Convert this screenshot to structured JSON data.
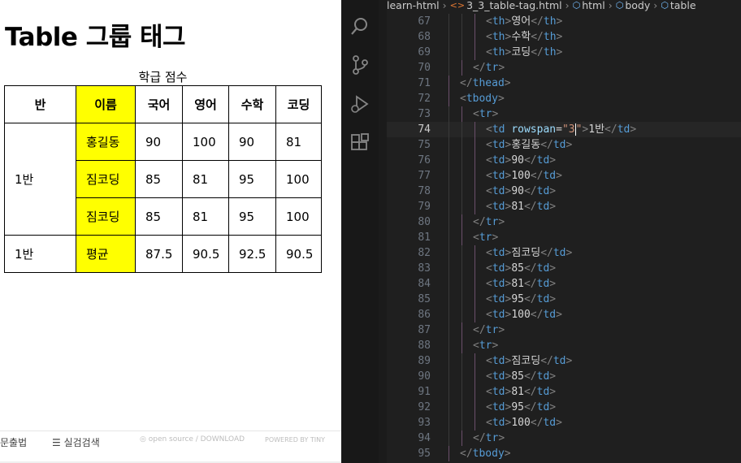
{
  "preview": {
    "title": "Table 그룹 태그",
    "caption": "학급 점수",
    "headers": [
      "반",
      "이름",
      "국어",
      "영어",
      "수학",
      "코딩"
    ],
    "group1": {
      "class": "1반",
      "rows": [
        {
          "name": "홍길동",
          "scores": [
            "90",
            "100",
            "90",
            "81"
          ]
        },
        {
          "name": "짐코딩",
          "scores": [
            "85",
            "81",
            "95",
            "100"
          ]
        },
        {
          "name": "짐코딩",
          "scores": [
            "85",
            "81",
            "95",
            "100"
          ]
        }
      ]
    },
    "avg_row": {
      "class": "1반",
      "name": "평균",
      "scores": [
        "87.5",
        "90.5",
        "92.5",
        "90.5"
      ]
    },
    "highlight_color": "#ffff00"
  },
  "bottom_strip": {
    "left_text": "문출법",
    "search_text": "실검검색",
    "open_source": "open source / DOWNLOAD",
    "powered": "POWERED BY TINY"
  },
  "editor": {
    "breadcrumb": [
      "learn-html",
      "3_3_table-tag.html",
      "html",
      "body",
      "table"
    ],
    "cursor_line": 74,
    "activity_icons": [
      "explorer-icon",
      "search-icon",
      "source-control-icon",
      "run-debug-icon",
      "extensions-icon"
    ],
    "lines": [
      {
        "n": "67",
        "indent": 3,
        "parts": [
          [
            "br",
            "<"
          ],
          [
            "tag",
            "th"
          ],
          [
            "br",
            ">"
          ],
          [
            "tx",
            "영어"
          ],
          [
            "br",
            "</"
          ],
          [
            "tag",
            "th"
          ],
          [
            "br",
            ">"
          ]
        ]
      },
      {
        "n": "68",
        "indent": 3,
        "parts": [
          [
            "br",
            "<"
          ],
          [
            "tag",
            "th"
          ],
          [
            "br",
            ">"
          ],
          [
            "tx",
            "수학"
          ],
          [
            "br",
            "</"
          ],
          [
            "tag",
            "th"
          ],
          [
            "br",
            ">"
          ]
        ]
      },
      {
        "n": "69",
        "indent": 3,
        "parts": [
          [
            "br",
            "<"
          ],
          [
            "tag",
            "th"
          ],
          [
            "br",
            ">"
          ],
          [
            "tx",
            "코딩"
          ],
          [
            "br",
            "</"
          ],
          [
            "tag",
            "th"
          ],
          [
            "br",
            ">"
          ]
        ]
      },
      {
        "n": "70",
        "indent": 2,
        "parts": [
          [
            "br",
            "</"
          ],
          [
            "tag",
            "tr"
          ],
          [
            "br",
            ">"
          ]
        ]
      },
      {
        "n": "71",
        "indent": 1,
        "parts": [
          [
            "br",
            "</"
          ],
          [
            "tag",
            "thead"
          ],
          [
            "br",
            ">"
          ]
        ]
      },
      {
        "n": "72",
        "indent": 1,
        "parts": [
          [
            "br",
            "<"
          ],
          [
            "tag",
            "tbody"
          ],
          [
            "br",
            ">"
          ]
        ]
      },
      {
        "n": "73",
        "indent": 2,
        "parts": [
          [
            "br",
            "<"
          ],
          [
            "tag",
            "tr"
          ],
          [
            "br",
            ">"
          ]
        ]
      },
      {
        "n": "74",
        "indent": 3,
        "parts": [
          [
            "br",
            "<"
          ],
          [
            "tag",
            "td"
          ],
          [
            "tx",
            " "
          ],
          [
            "attr",
            "rowspan"
          ],
          [
            "tx",
            "="
          ],
          [
            "str",
            "\"3"
          ],
          [
            "cursor",
            ""
          ],
          [
            "str",
            "\""
          ],
          [
            "br",
            ">"
          ],
          [
            "tx",
            "1반"
          ],
          [
            "br",
            "</"
          ],
          [
            "tag",
            "td"
          ],
          [
            "br",
            ">"
          ]
        ]
      },
      {
        "n": "75",
        "indent": 3,
        "parts": [
          [
            "br",
            "<"
          ],
          [
            "tag",
            "td"
          ],
          [
            "br",
            ">"
          ],
          [
            "tx",
            "홍길동"
          ],
          [
            "br",
            "</"
          ],
          [
            "tag",
            "td"
          ],
          [
            "br",
            ">"
          ]
        ]
      },
      {
        "n": "76",
        "indent": 3,
        "parts": [
          [
            "br",
            "<"
          ],
          [
            "tag",
            "td"
          ],
          [
            "br",
            ">"
          ],
          [
            "tx",
            "90"
          ],
          [
            "br",
            "</"
          ],
          [
            "tag",
            "td"
          ],
          [
            "br",
            ">"
          ]
        ]
      },
      {
        "n": "77",
        "indent": 3,
        "parts": [
          [
            "br",
            "<"
          ],
          [
            "tag",
            "td"
          ],
          [
            "br",
            ">"
          ],
          [
            "tx",
            "100"
          ],
          [
            "br",
            "</"
          ],
          [
            "tag",
            "td"
          ],
          [
            "br",
            ">"
          ]
        ]
      },
      {
        "n": "78",
        "indent": 3,
        "parts": [
          [
            "br",
            "<"
          ],
          [
            "tag",
            "td"
          ],
          [
            "br",
            ">"
          ],
          [
            "tx",
            "90"
          ],
          [
            "br",
            "</"
          ],
          [
            "tag",
            "td"
          ],
          [
            "br",
            ">"
          ]
        ]
      },
      {
        "n": "79",
        "indent": 3,
        "parts": [
          [
            "br",
            "<"
          ],
          [
            "tag",
            "td"
          ],
          [
            "br",
            ">"
          ],
          [
            "tx",
            "81"
          ],
          [
            "br",
            "</"
          ],
          [
            "tag",
            "td"
          ],
          [
            "br",
            ">"
          ]
        ]
      },
      {
        "n": "80",
        "indent": 2,
        "parts": [
          [
            "br",
            "</"
          ],
          [
            "tag",
            "tr"
          ],
          [
            "br",
            ">"
          ]
        ]
      },
      {
        "n": "81",
        "indent": 2,
        "parts": [
          [
            "br",
            "<"
          ],
          [
            "tag",
            "tr"
          ],
          [
            "br",
            ">"
          ]
        ]
      },
      {
        "n": "82",
        "indent": 3,
        "parts": [
          [
            "br",
            "<"
          ],
          [
            "tag",
            "td"
          ],
          [
            "br",
            ">"
          ],
          [
            "tx",
            "짐코딩"
          ],
          [
            "br",
            "</"
          ],
          [
            "tag",
            "td"
          ],
          [
            "br",
            ">"
          ]
        ]
      },
      {
        "n": "83",
        "indent": 3,
        "parts": [
          [
            "br",
            "<"
          ],
          [
            "tag",
            "td"
          ],
          [
            "br",
            ">"
          ],
          [
            "tx",
            "85"
          ],
          [
            "br",
            "</"
          ],
          [
            "tag",
            "td"
          ],
          [
            "br",
            ">"
          ]
        ]
      },
      {
        "n": "84",
        "indent": 3,
        "parts": [
          [
            "br",
            "<"
          ],
          [
            "tag",
            "td"
          ],
          [
            "br",
            ">"
          ],
          [
            "tx",
            "81"
          ],
          [
            "br",
            "</"
          ],
          [
            "tag",
            "td"
          ],
          [
            "br",
            ">"
          ]
        ]
      },
      {
        "n": "85",
        "indent": 3,
        "parts": [
          [
            "br",
            "<"
          ],
          [
            "tag",
            "td"
          ],
          [
            "br",
            ">"
          ],
          [
            "tx",
            "95"
          ],
          [
            "br",
            "</"
          ],
          [
            "tag",
            "td"
          ],
          [
            "br",
            ">"
          ]
        ]
      },
      {
        "n": "86",
        "indent": 3,
        "parts": [
          [
            "br",
            "<"
          ],
          [
            "tag",
            "td"
          ],
          [
            "br",
            ">"
          ],
          [
            "tx",
            "100"
          ],
          [
            "br",
            "</"
          ],
          [
            "tag",
            "td"
          ],
          [
            "br",
            ">"
          ]
        ]
      },
      {
        "n": "87",
        "indent": 2,
        "parts": [
          [
            "br",
            "</"
          ],
          [
            "tag",
            "tr"
          ],
          [
            "br",
            ">"
          ]
        ]
      },
      {
        "n": "88",
        "indent": 2,
        "parts": [
          [
            "br",
            "<"
          ],
          [
            "tag",
            "tr"
          ],
          [
            "br",
            ">"
          ]
        ]
      },
      {
        "n": "89",
        "indent": 3,
        "parts": [
          [
            "br",
            "<"
          ],
          [
            "tag",
            "td"
          ],
          [
            "br",
            ">"
          ],
          [
            "tx",
            "짐코딩"
          ],
          [
            "br",
            "</"
          ],
          [
            "tag",
            "td"
          ],
          [
            "br",
            ">"
          ]
        ]
      },
      {
        "n": "90",
        "indent": 3,
        "parts": [
          [
            "br",
            "<"
          ],
          [
            "tag",
            "td"
          ],
          [
            "br",
            ">"
          ],
          [
            "tx",
            "85"
          ],
          [
            "br",
            "</"
          ],
          [
            "tag",
            "td"
          ],
          [
            "br",
            ">"
          ]
        ]
      },
      {
        "n": "91",
        "indent": 3,
        "parts": [
          [
            "br",
            "<"
          ],
          [
            "tag",
            "td"
          ],
          [
            "br",
            ">"
          ],
          [
            "tx",
            "81"
          ],
          [
            "br",
            "</"
          ],
          [
            "tag",
            "td"
          ],
          [
            "br",
            ">"
          ]
        ]
      },
      {
        "n": "92",
        "indent": 3,
        "parts": [
          [
            "br",
            "<"
          ],
          [
            "tag",
            "td"
          ],
          [
            "br",
            ">"
          ],
          [
            "tx",
            "95"
          ],
          [
            "br",
            "</"
          ],
          [
            "tag",
            "td"
          ],
          [
            "br",
            ">"
          ]
        ]
      },
      {
        "n": "93",
        "indent": 3,
        "parts": [
          [
            "br",
            "<"
          ],
          [
            "tag",
            "td"
          ],
          [
            "br",
            ">"
          ],
          [
            "tx",
            "100"
          ],
          [
            "br",
            "</"
          ],
          [
            "tag",
            "td"
          ],
          [
            "br",
            ">"
          ]
        ]
      },
      {
        "n": "94",
        "indent": 2,
        "parts": [
          [
            "br",
            "</"
          ],
          [
            "tag",
            "tr"
          ],
          [
            "br",
            ">"
          ]
        ]
      },
      {
        "n": "95",
        "indent": 1,
        "parts": [
          [
            "br",
            "</"
          ],
          [
            "tag",
            "tbody"
          ],
          [
            "br",
            ">"
          ]
        ]
      }
    ],
    "colors": {
      "bg": "#1f1f1f",
      "tag": "#569cd6",
      "attr": "#9cdcfe",
      "string": "#ce9178",
      "text": "#d4d4d4",
      "line_number": "#6e7681"
    }
  }
}
